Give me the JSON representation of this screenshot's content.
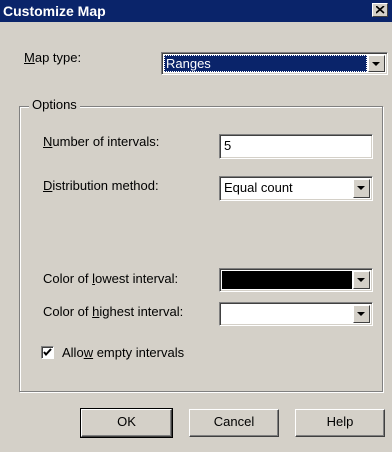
{
  "window": {
    "title": "Customize Map",
    "close_glyph": "close-icon"
  },
  "map_type": {
    "label_pre": "",
    "label_key": "M",
    "label_post": "ap type:",
    "value": "Ranges"
  },
  "options": {
    "legend": "Options",
    "intervals": {
      "label_key": "N",
      "label_post": "umber of intervals:",
      "value": "5"
    },
    "distribution": {
      "label_key": "D",
      "label_post": "istribution method:",
      "value": "Equal count"
    },
    "lowest_color": {
      "label_pre": "Color of ",
      "label_key": "l",
      "label_post": "owest interval:",
      "swatch": "#000000"
    },
    "highest_color": {
      "label_pre": "Color of ",
      "label_key": "h",
      "label_post": "ighest interval:",
      "swatch": "#ffffff"
    },
    "allow_empty": {
      "label_pre": "Allo",
      "label_key": "w",
      "label_post": " empty intervals",
      "checked": true
    }
  },
  "buttons": {
    "ok": "OK",
    "cancel": "Cancel",
    "help": "Help"
  }
}
